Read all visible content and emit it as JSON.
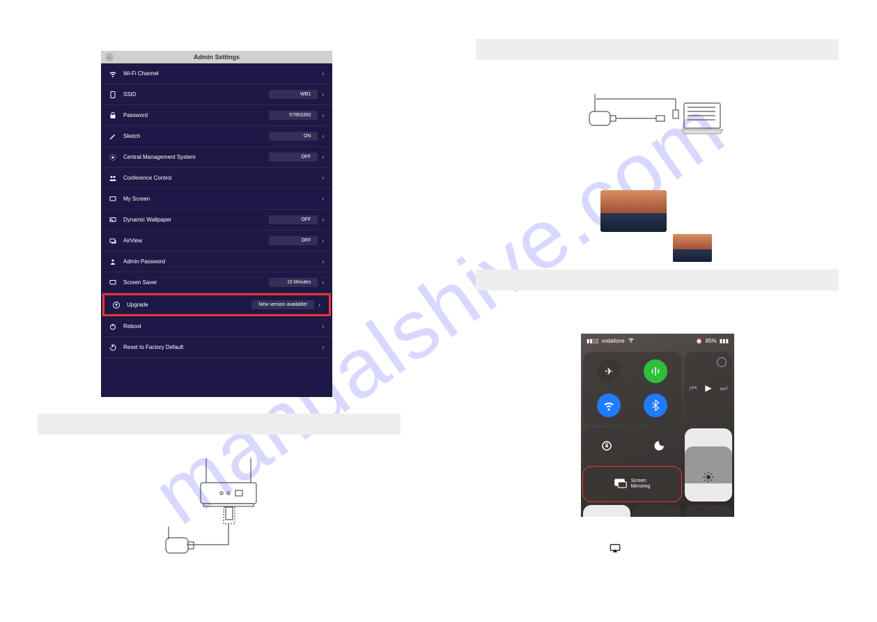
{
  "watermark": "manualshive.com",
  "admin": {
    "title": "Admin Settings",
    "rows": {
      "wifi": "Wi-Fi Channel",
      "ssid_label": "SSID",
      "ssid_val": "WB1",
      "pwd_label": "Password",
      "pwd_val": "57953350",
      "sketch_label": "Sketch",
      "sketch_val": "ON",
      "cms_label": "Central Management System",
      "cms_val": "OFF",
      "conf": "Conference Control",
      "myscreen": "My Screen",
      "dw_label": "Dynamic Wallpaper",
      "dw_val": "OFF",
      "av_label": "AirView",
      "av_val": "OFF",
      "adminpwd": "Admin Password",
      "ss_label": "Screen Saver",
      "ss_val": "15 Minutes",
      "upg_label": "Upgrade",
      "upg_val": "New version available!",
      "reboot": "Reboot",
      "reset": "Reset to Factory Default"
    }
  },
  "cc": {
    "carrier": "vodafone",
    "battery": "85%",
    "screen_mirroring": "Screen\nMirroring"
  }
}
